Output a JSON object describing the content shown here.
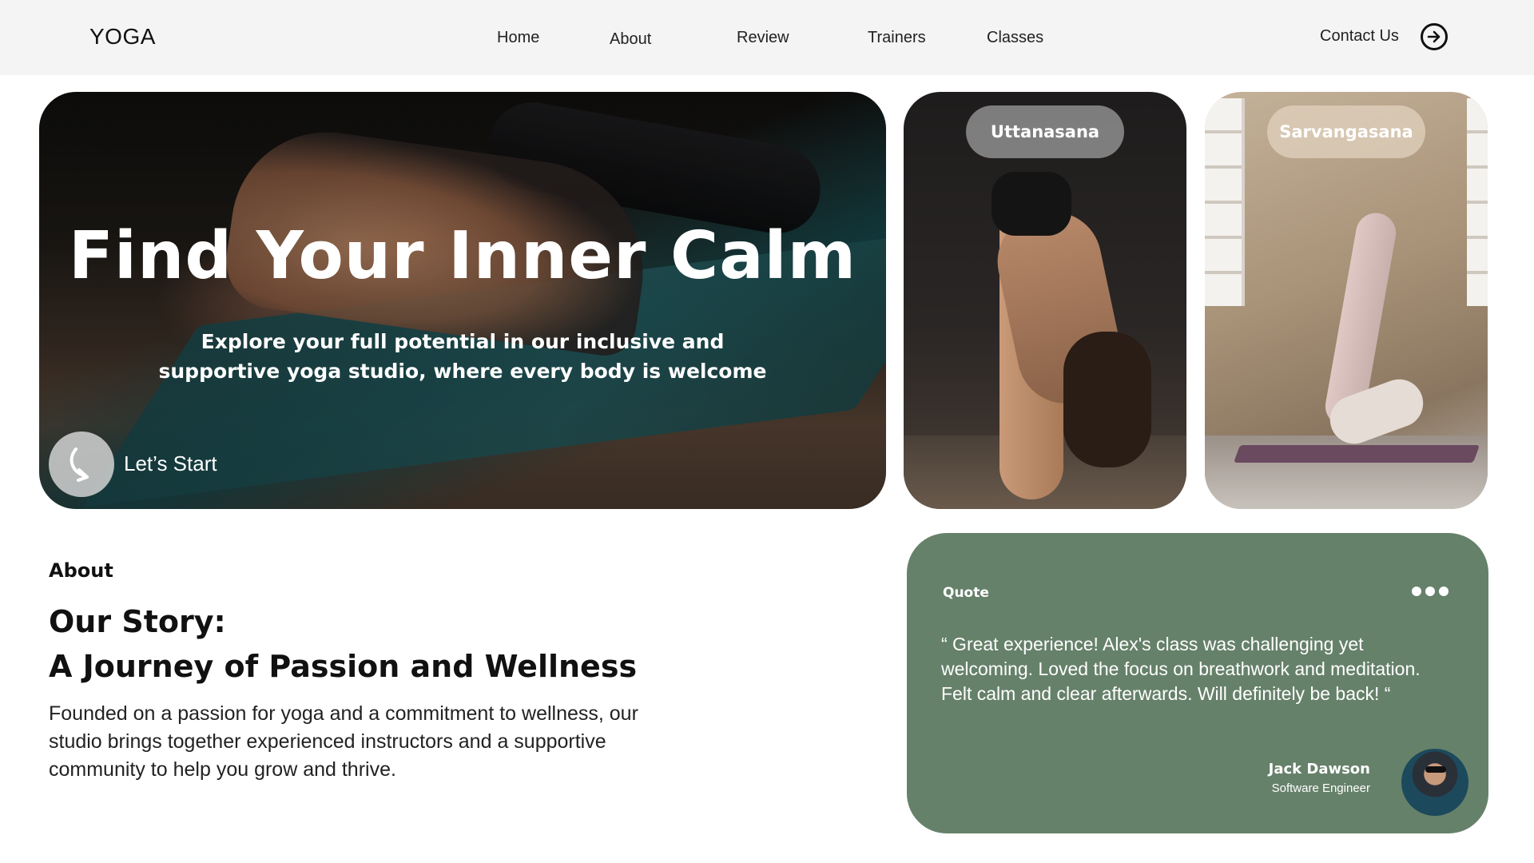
{
  "nav": {
    "logo": "YOGA",
    "links": [
      "Home",
      "About",
      "Review",
      "Trainers",
      "Classes"
    ],
    "contact_label": "Contact Us",
    "contact_icon": "arrow-right-circle-icon"
  },
  "hero": {
    "title": "Find Your Inner Calm",
    "subtitle": "Explore your full potential in our inclusive and supportive yoga studio, where every body is welcome",
    "cta_label": "Let’s Start",
    "cta_icon": "curved-arrow-icon"
  },
  "poses": [
    {
      "label": "Uttanasana"
    },
    {
      "label": "Sarvangasana"
    }
  ],
  "about": {
    "eyebrow": "About",
    "title_line1": "Our Story:",
    "title_line2": "A Journey of Passion and Wellness",
    "body": "Founded on a passion for yoga and a commitment to wellness, our studio brings together experienced instructors and a supportive community to help you grow and thrive."
  },
  "quote": {
    "label": "Quote",
    "text": "“ Great experience! Alex's class was challenging yet welcoming. Loved the focus on breathwork and meditation. Felt calm and clear afterwards. Will definitely be back! “",
    "author_name": "Jack Dawson",
    "author_role": "Software Engineer",
    "accent_color": "#66816a"
  }
}
